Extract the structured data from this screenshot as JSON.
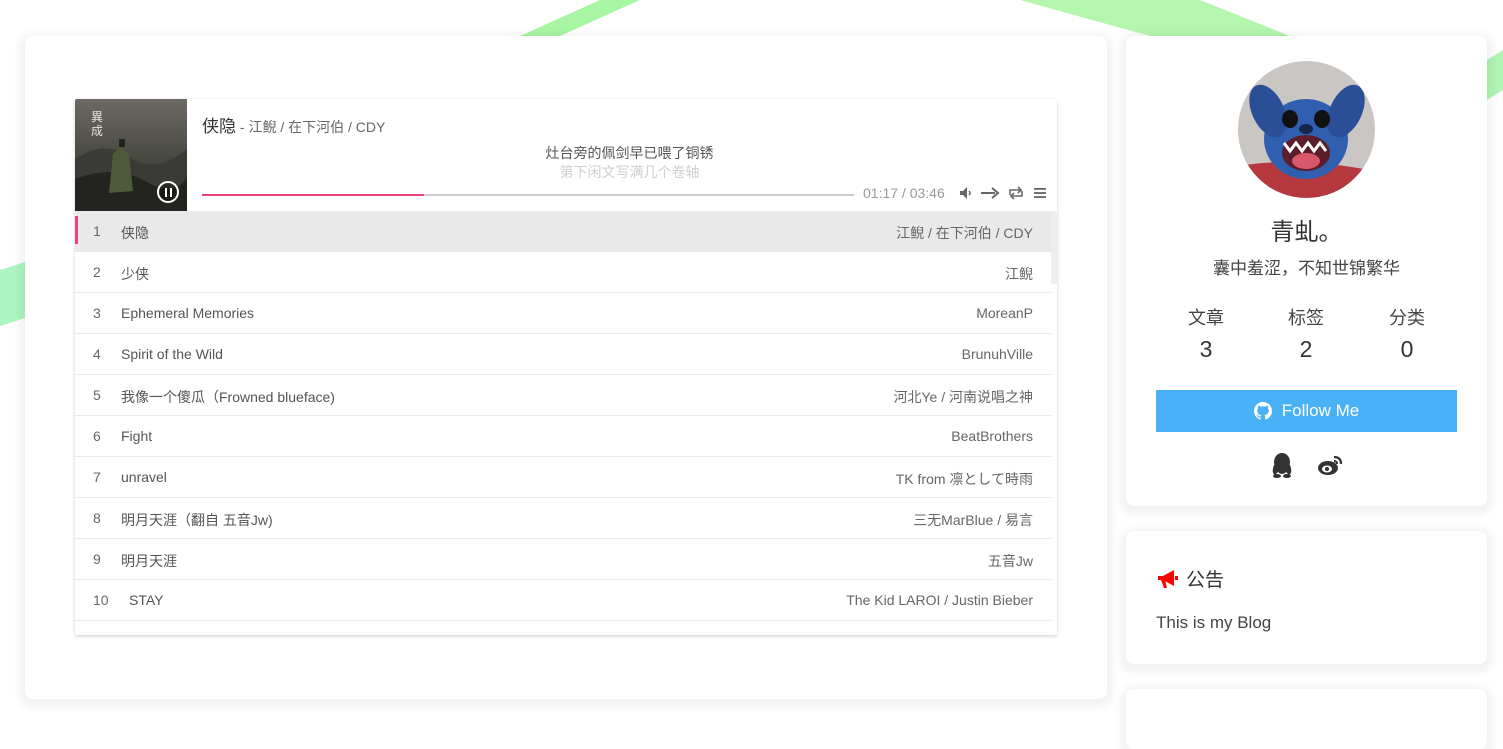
{
  "player": {
    "title": "侠隐",
    "author_sep": " - ",
    "author": "江鲵 / 在下河伯 / CDY",
    "lyric_current": "灶台旁的佩剑早已喂了铜锈",
    "lyric_next": "第下闲文写满几个卷轴",
    "progress_fraction": 0.34,
    "time_current": "01:17",
    "time_sep": " / ",
    "time_total": "03:46",
    "accent_color": "#e8407a",
    "icons": [
      "pause-icon",
      "volume-icon",
      "order-icon",
      "loop-icon",
      "menu-icon"
    ]
  },
  "playlist": [
    {
      "index": "1",
      "name": "侠隐",
      "artist": "江鲵 / 在下河伯 / CDY"
    },
    {
      "index": "2",
      "name": "少侠",
      "artist": "江鲵"
    },
    {
      "index": "3",
      "name": "Ephemeral Memories",
      "artist": "MoreanP"
    },
    {
      "index": "4",
      "name": "Spirit of the Wild",
      "artist": "BrunuhVille"
    },
    {
      "index": "5",
      "name": "我像一个傻瓜（Frowned blueface)",
      "artist": "河北Ye / 河南说唱之神"
    },
    {
      "index": "6",
      "name": "Fight",
      "artist": "BeatBrothers"
    },
    {
      "index": "7",
      "name": "unravel",
      "artist": "TK from 凛として時雨"
    },
    {
      "index": "8",
      "name": "明月天涯（翻自 五音Jw)",
      "artist": "三无MarBlue / 易言"
    },
    {
      "index": "9",
      "name": "明月天涯",
      "artist": "五音Jw"
    },
    {
      "index": "10",
      "name": "STAY",
      "artist": "The Kid LAROI / Justin Bieber"
    }
  ],
  "author": {
    "name": "青虬。",
    "description": "囊中羞涩，不知世锦繁华",
    "stats": [
      {
        "label": "文章",
        "value": "3"
      },
      {
        "label": "标签",
        "value": "2"
      },
      {
        "label": "分类",
        "value": "0"
      }
    ],
    "follow_label": "Follow Me",
    "follow_color": "#49b1f5",
    "social_icons": [
      "qq-icon",
      "weibo-icon"
    ]
  },
  "announcement": {
    "title": "公告",
    "text": "This is my Blog",
    "icon": "bullhorn-icon",
    "icon_color": "#ff0000"
  }
}
